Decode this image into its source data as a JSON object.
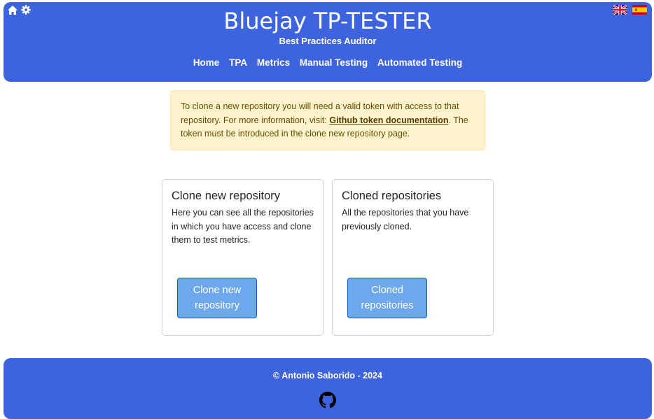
{
  "header": {
    "title": "Bluejay TP-TESTER",
    "subtitle": "Best Practices Auditor",
    "icons": [
      "home-icon",
      "gear-icon"
    ],
    "languages": [
      "uk-flag-icon",
      "spain-flag-icon"
    ],
    "nav": [
      "Home",
      "TPA",
      "Metrics",
      "Manual Testing",
      "Automated Testing"
    ]
  },
  "alert": {
    "text_before": "To clone a new repository you will need a valid token with access to that repository. For more information, visit: ",
    "link": "Github token documentation",
    "text_after": ". The token must be introduced in the clone new repository page."
  },
  "cards": [
    {
      "title": "Clone new repository",
      "text": "Here you can see all the repositories in which you have access and clone them to test metrics.",
      "button": "Clone new repository"
    },
    {
      "title": "Cloned repositories",
      "text": "All the repositories that you have previously cloned.",
      "button": "Cloned repositories"
    }
  ],
  "footer": {
    "copyright": "© Antonio Saborido - 2024",
    "icon": "github-icon"
  },
  "colors": {
    "brand": "#3d63dd",
    "alert_bg": "#fff3cd",
    "button_bg": "#6ea8ec"
  }
}
